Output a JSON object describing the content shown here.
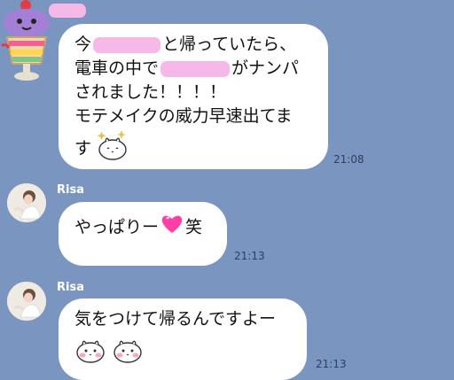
{
  "theme": {
    "background": "#7a95bf",
    "bubble": "#ffffff",
    "redaction": "#f6b8e6"
  },
  "messages": [
    {
      "sender": "",
      "avatar_icon": "parfait-icon",
      "lines": [
        [
          "今",
          "[redacted]",
          "と帰っていたら、"
        ],
        [
          "電車の中で",
          "[redacted]",
          "がナンパ"
        ],
        [
          "されました！！！！"
        ],
        [
          "モテメイクの威力早速出てま"
        ],
        [
          "す"
        ]
      ],
      "emoji": [
        "sparkle-rabbit-icon"
      ],
      "time": "21:08"
    },
    {
      "sender": "Risa",
      "avatar_icon": "risa-photo",
      "text": "やっぱりー",
      "emoji": [
        "pink-heart-icon"
      ],
      "suffix": "笑",
      "time": "21:13"
    },
    {
      "sender": "Risa",
      "avatar_icon": "risa-photo",
      "text": "気をつけて帰るんですよー",
      "emoji": [
        "blushing-rabbit-icon",
        "blushing-rabbit-icon"
      ],
      "time": "21:13"
    }
  ]
}
